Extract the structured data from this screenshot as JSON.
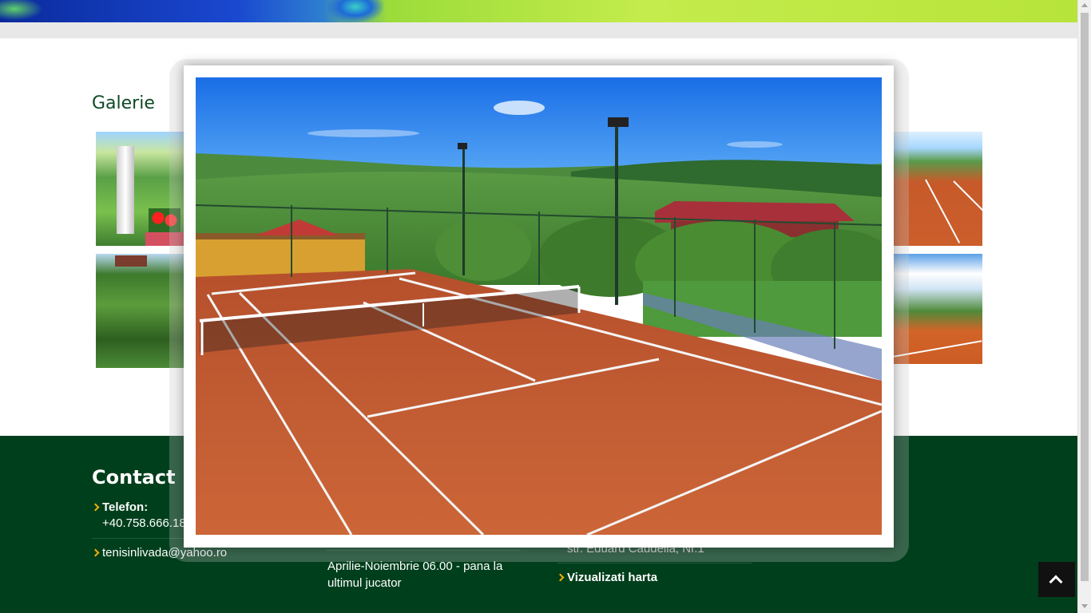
{
  "gallery": {
    "title": "Galerie"
  },
  "footer": {
    "contact_title": "Contact",
    "phone_label": "Telefon:",
    "phone_value": "+40.758.666.18",
    "email": "tenisinlivada@yahoo.ro",
    "hours": "Aprilie-Noiembrie 06.00 - pana la ultimul jucator",
    "address": "str. Eduard Caudella, Nr.1",
    "map_link": "Vizualizati harta"
  },
  "icons": {
    "back_to_top": "chevron-up-icon",
    "bullet": "chevron-right-icon"
  },
  "colors": {
    "footer_bg": "#003f1c",
    "accent": "#f0b000",
    "title_green": "#0d4a24",
    "clay": "#c65a2e"
  }
}
